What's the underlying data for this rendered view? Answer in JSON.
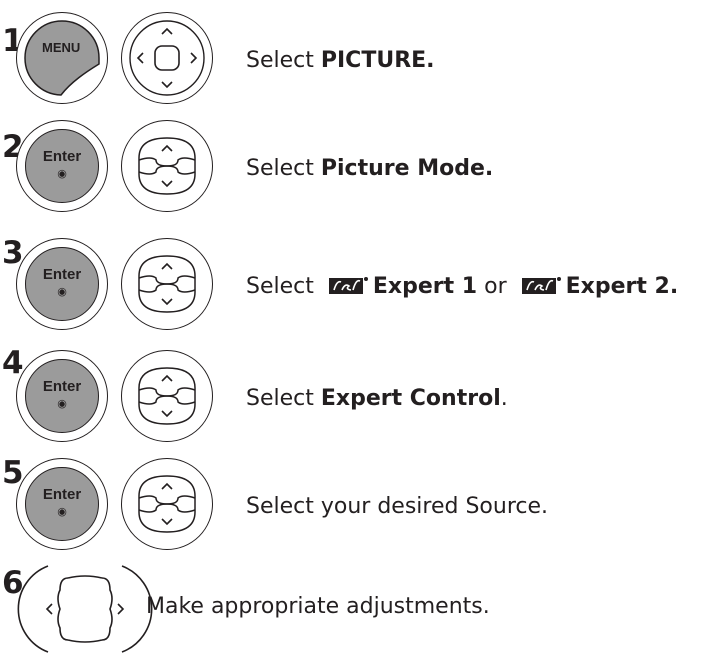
{
  "steps": [
    {
      "number": "1",
      "button": "MENU",
      "nav_type": "four-way",
      "text": "Select ",
      "bold": "PICTURE."
    },
    {
      "number": "2",
      "button": "Enter",
      "nav_type": "up-down",
      "text": "Select ",
      "bold": "Picture Mode."
    },
    {
      "number": "3",
      "button": "Enter",
      "nav_type": "up-down",
      "text": "Select ",
      "bold_a": "Expert 1",
      "connector": " or ",
      "bold_b": "Expert 2.",
      "logo_icon": "isf-logo-icon"
    },
    {
      "number": "4",
      "button": "Enter",
      "nav_type": "up-down",
      "text": "Select ",
      "bold": "Expert Control",
      "tail": "."
    },
    {
      "number": "5",
      "button": "Enter",
      "nav_type": "up-down",
      "text": "Select your desired Source."
    },
    {
      "number": "6",
      "nav_type": "left-right",
      "text": "Make appropriate adjustments."
    }
  ],
  "icons": {
    "enter_dot": "◉"
  },
  "colors": {
    "button_fill": "#9b9b9b",
    "ink": "#231f20"
  }
}
